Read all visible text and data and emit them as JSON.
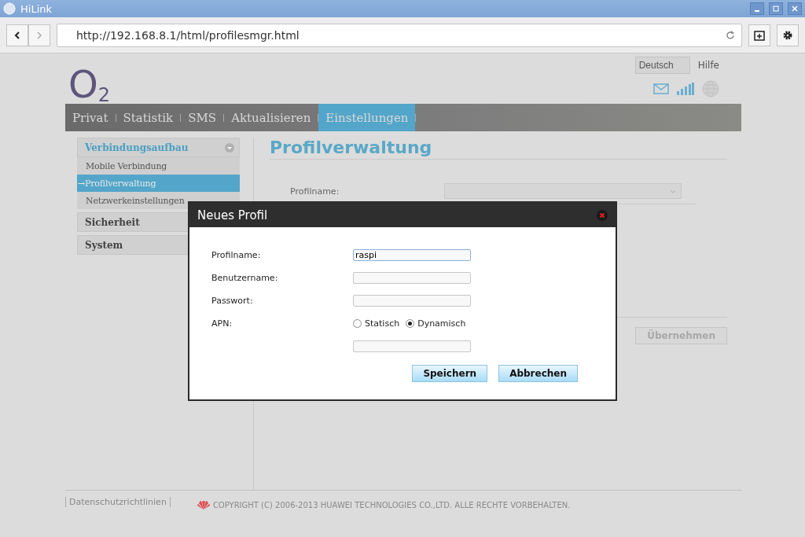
{
  "window": {
    "title": "HiLink"
  },
  "browser": {
    "url": "http://192.168.8.1/html/profilesmgr.html"
  },
  "header": {
    "logo": {
      "letter": "O",
      "subscript": "2"
    },
    "language": "Deutsch",
    "help": "Hilfe"
  },
  "nav": [
    {
      "label": "Privat",
      "selected": false
    },
    {
      "label": "Statistik",
      "selected": false
    },
    {
      "label": "SMS",
      "selected": false
    },
    {
      "label": "Aktualisieren",
      "selected": false
    },
    {
      "label": "Einstellungen",
      "selected": true
    }
  ],
  "sidebar": [
    {
      "label": "Verbindungsaufbau",
      "expanded": true,
      "children": [
        {
          "label": "Mobile Verbindung",
          "selected": false
        },
        {
          "label": "→Profilverwaltung",
          "selected": true
        },
        {
          "label": "Netzwerkeinstellungen",
          "selected": false
        }
      ]
    },
    {
      "label": "Sicherheit",
      "expanded": false
    },
    {
      "label": "System",
      "expanded": false
    }
  ],
  "main": {
    "title": "Profilverwaltung",
    "field_label": "Profilname:",
    "apply_button": "Übernehmen"
  },
  "dialog": {
    "title": "Neues Profil",
    "fields": [
      {
        "label": "Profilname:",
        "value": "raspi",
        "focused": true
      },
      {
        "label": "Benutzername:",
        "focused": false
      },
      {
        "label": "Passwort:",
        "focused": false
      }
    ],
    "apn": {
      "label": "APN:",
      "options": [
        {
          "label": "Statisch",
          "selected": false
        },
        {
          "label": "Dynamisch",
          "selected": true
        }
      ]
    },
    "buttons": [
      "Speichern",
      "Abbrechen"
    ]
  },
  "footer": {
    "link": "Datenschutzrichtlinien",
    "copyright": "COPYRIGHT (C) 2006-2013 HUAWEI TECHNOLOGIES CO.,LTD. ALLE RECHTE VORBEHALTEN."
  }
}
